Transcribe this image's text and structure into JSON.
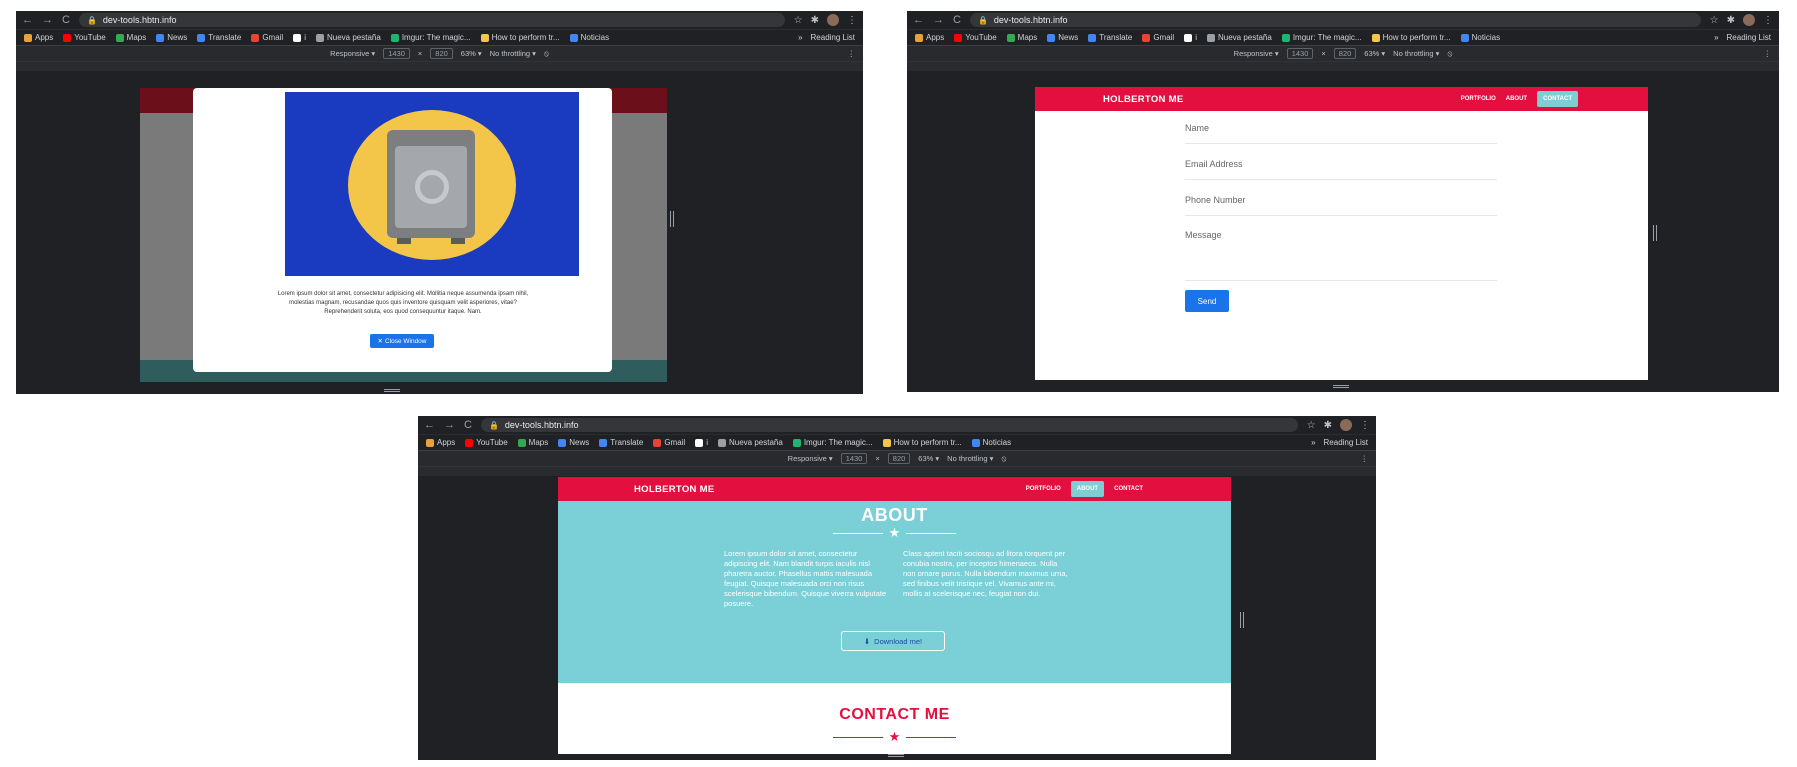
{
  "browser": {
    "url": "dev-tools.hbtn.info",
    "bookmarks": [
      {
        "label": "Apps",
        "icon": "apps-grid-icon",
        "color": "#e8a13b"
      },
      {
        "label": "YouTube",
        "icon": "youtube-icon",
        "color": "#ff0000"
      },
      {
        "label": "Maps",
        "icon": "maps-icon",
        "color": "#34a853"
      },
      {
        "label": "News",
        "icon": "news-icon",
        "color": "#4285f4"
      },
      {
        "label": "Translate",
        "icon": "translate-icon",
        "color": "#4285f4"
      },
      {
        "label": "Gmail",
        "icon": "gmail-icon",
        "color": "#ea4335"
      },
      {
        "label": "i",
        "icon": "info-icon",
        "color": "#ffffff"
      },
      {
        "label": "Nueva pestaña",
        "icon": "globe-icon",
        "color": "#9aa0a6"
      },
      {
        "label": "Imgur: The magic...",
        "icon": "imgur-icon",
        "color": "#1bb76e"
      },
      {
        "label": "How to perform tr...",
        "icon": "howto-icon",
        "color": "#f3c649"
      },
      {
        "label": "Noticias",
        "icon": "noticias-icon",
        "color": "#4285f4"
      }
    ],
    "bookmarks_overflow": "»",
    "reading_list": "Reading List",
    "devtools": {
      "device": "Responsive ▾",
      "width": "1430",
      "times": "×",
      "height": "820",
      "zoom": "63% ▾",
      "throttle": "No throttling ▾"
    }
  },
  "site": {
    "brand": "HOLBERTON ME",
    "nav": [
      "PORTFOLIO",
      "ABOUT",
      "CONTACT"
    ]
  },
  "modal": {
    "text": "Lorem ipsum dolor sit amet, consectetur adipisicing elit. Mollitia neque assumenda ipsam nihil, molestias magnam, recusandae quos quis inventore quisquam velit asperiores, vitae? Reprehenderit soluta, eos quod consequuntur itaque. Nam.",
    "close_label": "Close Window"
  },
  "contact_form": {
    "name": "Name",
    "email": "Email Address",
    "phone": "Phone Number",
    "message": "Message",
    "send": "Send"
  },
  "about": {
    "title": "ABOUT",
    "col1": "Lorem ipsum dolor sit amet, consectetur adipiscing elit. Nam blandit turpis iaculis nisl pharetra auctor. Phasellus mattis malesuada feugiat. Quisque malesuada orci non risus scelerisque bibendum. Quisque viverra vulputate posuere.",
    "col2": "Class aptent taciti sociosqu ad litora torquent per conubia nostra, per inceptos himenaeos. Nulla non ornare purus. Nulla bibendum maximus urna, sed finibus velit tristique vel. Vivamus ante mi, mollis at scelerisque nec, feugiat non dui.",
    "download": "Download me!",
    "contact_title": "CONTACT ME"
  },
  "colors": {
    "brand_red": "#e3103f",
    "teal": "#7bcfd6",
    "button_blue": "#1a73e8"
  }
}
